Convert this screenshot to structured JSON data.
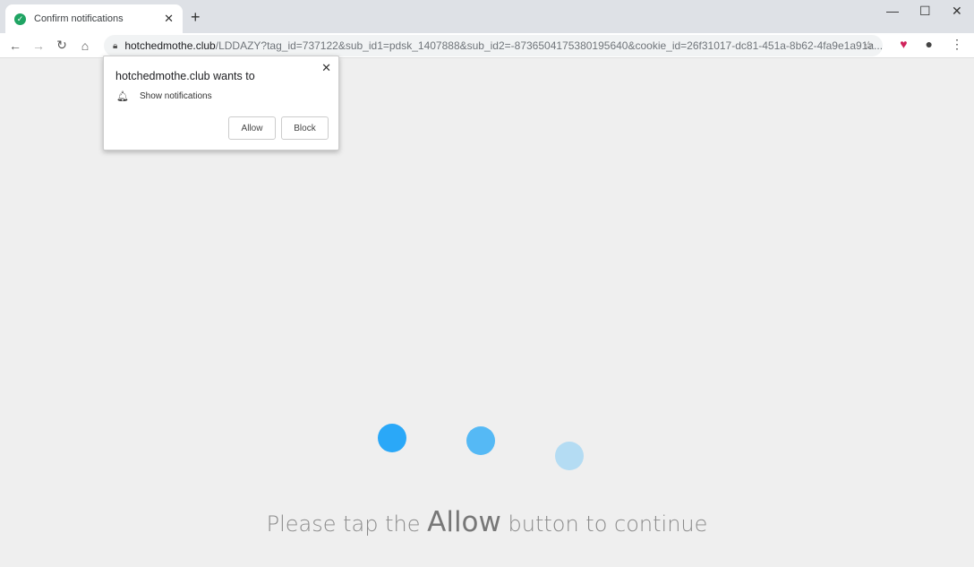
{
  "tab": {
    "title": "Confirm notifications",
    "favicon": "check-circle-icon"
  },
  "address": {
    "host": "hotchedmothe.club",
    "path": "/LDDAZY?tag_id=737122&sub_id1=pdsk_1407888&sub_id2=-8736504175380195640&cookie_id=26f31017-dc81-451a-8b62-4fa9e1a91a..."
  },
  "popup": {
    "heading": "hotchedmothe.club wants to",
    "permission": "Show notifications",
    "allow": "Allow",
    "block": "Block"
  },
  "page": {
    "msg_before": "Please tap the ",
    "msg_bold": "Allow",
    "msg_after": " button to continue"
  },
  "colors": {
    "dot1": "#2aa8f8",
    "dot2": "#55b9f5",
    "dot3": "#b4dcf3"
  }
}
